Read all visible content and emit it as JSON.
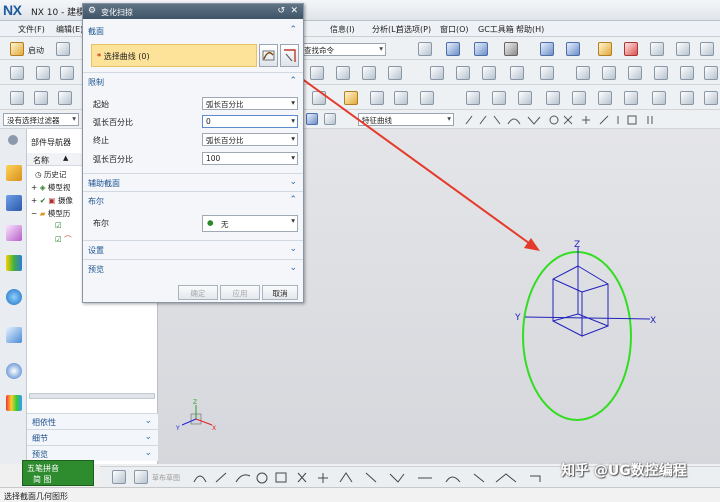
{
  "app": {
    "logo": "NX",
    "title": "NX 10 - 建模"
  },
  "menu": [
    {
      "label": "文件(F)"
    },
    {
      "label": "编辑(E)"
    },
    {
      "label": "信息(I)"
    },
    {
      "label": "分析(L)"
    },
    {
      "label": "首选项(P)"
    },
    {
      "label": "窗口(O)"
    },
    {
      "label": "GC工具箱"
    },
    {
      "label": "帮助(H)"
    }
  ],
  "toolbar": {
    "start_label": "启动",
    "command_search": "查找命令",
    "selection_filter": "没有选择过滤器",
    "curve_rule": "特征曲线"
  },
  "navigator": {
    "title": "部件导航器",
    "col_name": "名称",
    "items": [
      "历史记",
      "模型视",
      "摄像",
      "模型历"
    ]
  },
  "nav_sections": [
    {
      "label": "相依性"
    },
    {
      "label": "细节"
    },
    {
      "label": "预览"
    }
  ],
  "dialog": {
    "title": "变化扫掠",
    "section_profile": "截面",
    "select_curve": "选择曲线 (0)",
    "section_limits": "限制",
    "start_label": "起始",
    "start_mode": "弧长百分比",
    "start_pct_label": "弧长百分比",
    "start_pct_value": "0",
    "end_label": "终止",
    "end_mode": "弧长百分比",
    "end_pct_label": "弧长百分比",
    "end_pct_value": "100",
    "section_aux": "辅助截面",
    "section_boolean": "布尔",
    "boolean_label": "布尔",
    "boolean_value": "无",
    "section_settings": "设置",
    "section_preview": "预览",
    "ok": "确定",
    "apply": "应用",
    "cancel": "取消"
  },
  "viewport": {
    "axis_x": "X",
    "axis_y": "Y",
    "axis_z": "Z",
    "triad_x": "X",
    "triad_y": "Y",
    "triad_z": "Z"
  },
  "ime": {
    "name": "五笔拼音",
    "row2": "简 图"
  },
  "bottom_toolbar": {
    "label": "草布草图"
  },
  "status": "选择截面几何图形",
  "watermark": "知乎 @UG数控编程",
  "colors": {
    "circle": "#33dd22",
    "arrow": "#e53a2a",
    "dialog_header": "#4a5f72",
    "selection_highlight": "#fde39a"
  }
}
